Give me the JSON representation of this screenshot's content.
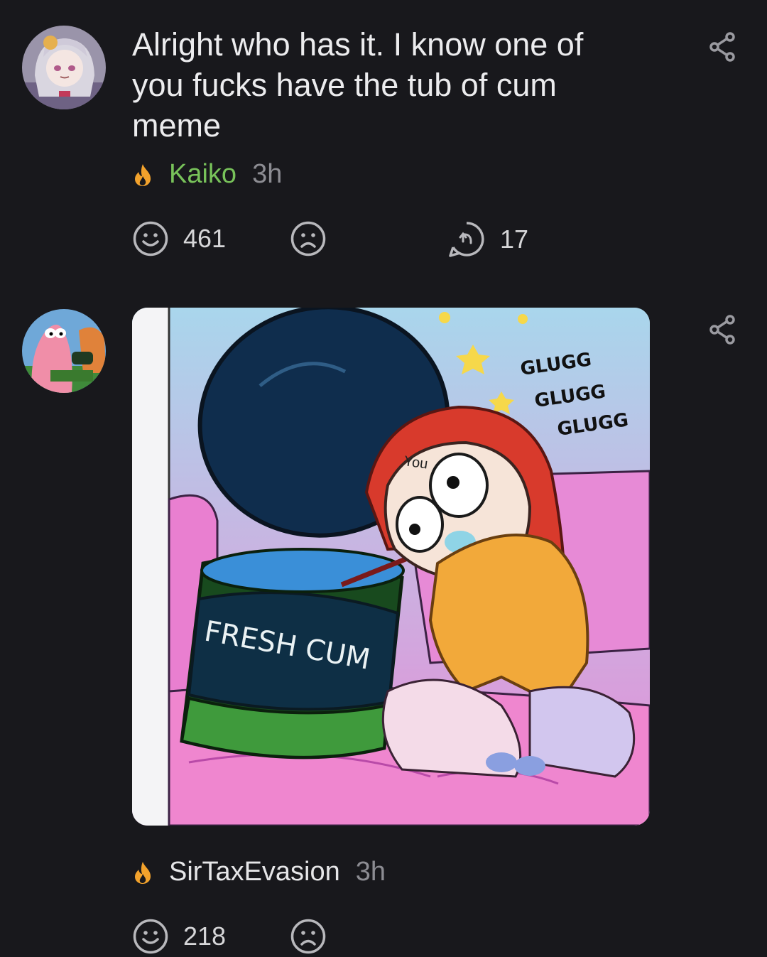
{
  "post": {
    "text": "Alright who has it. I know one of you fucks have the tub of cum meme",
    "author": "Kaiko",
    "time": "3h",
    "likes": "461",
    "replies": "17"
  },
  "reply": {
    "author": "SirTaxEvasion",
    "time": "3h",
    "likes": "218",
    "image": {
      "label_you": "You",
      "sound": [
        "GLUGG",
        "GLUGG",
        "GLUGG"
      ],
      "tub_text": "FRESH CUM"
    }
  },
  "icons": {
    "share": "share-icon",
    "flame": "flame-icon",
    "smile": "smile-icon",
    "frown": "frown-icon",
    "reply": "reply-icon"
  },
  "colors": {
    "background": "#18181c",
    "author_green": "#78c25a",
    "flame_orange": "#f2a22c"
  }
}
